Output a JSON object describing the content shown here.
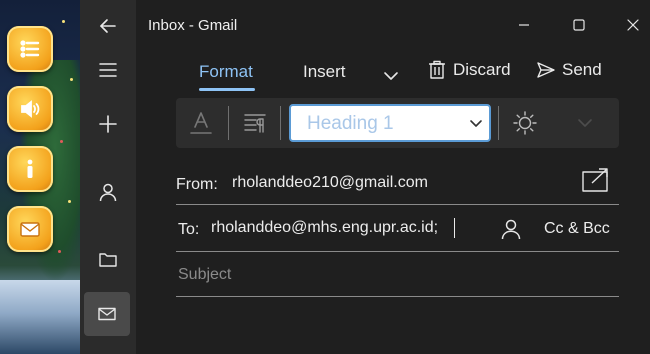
{
  "window": {
    "title": "Inbox - Gmail"
  },
  "desktop_icons": [
    "list-icon",
    "speaker-icon",
    "info-icon",
    "mail-icon"
  ],
  "rail": {
    "items": [
      "back-icon",
      "menu-icon",
      "new-mail-icon",
      "person-icon",
      "folder-icon",
      "mail-icon"
    ]
  },
  "tabs": [
    {
      "label": "Format"
    },
    {
      "label": "Insert"
    }
  ],
  "actions": {
    "discard": "Discard",
    "send": "Send"
  },
  "toolbar": {
    "heading_value": "Heading 1"
  },
  "compose": {
    "from_label": "From:",
    "from_value": "rholanddeo210@gmail.com",
    "to_label": "To:",
    "to_value": "rholanddeo@mhs.eng.upr.ac.id;",
    "cc_bcc": "Cc & Bcc",
    "subject_placeholder": "Subject"
  },
  "colors": {
    "accent": "#8ec3f5",
    "background": "#1f1f1f",
    "rail": "#2b2b2b"
  }
}
